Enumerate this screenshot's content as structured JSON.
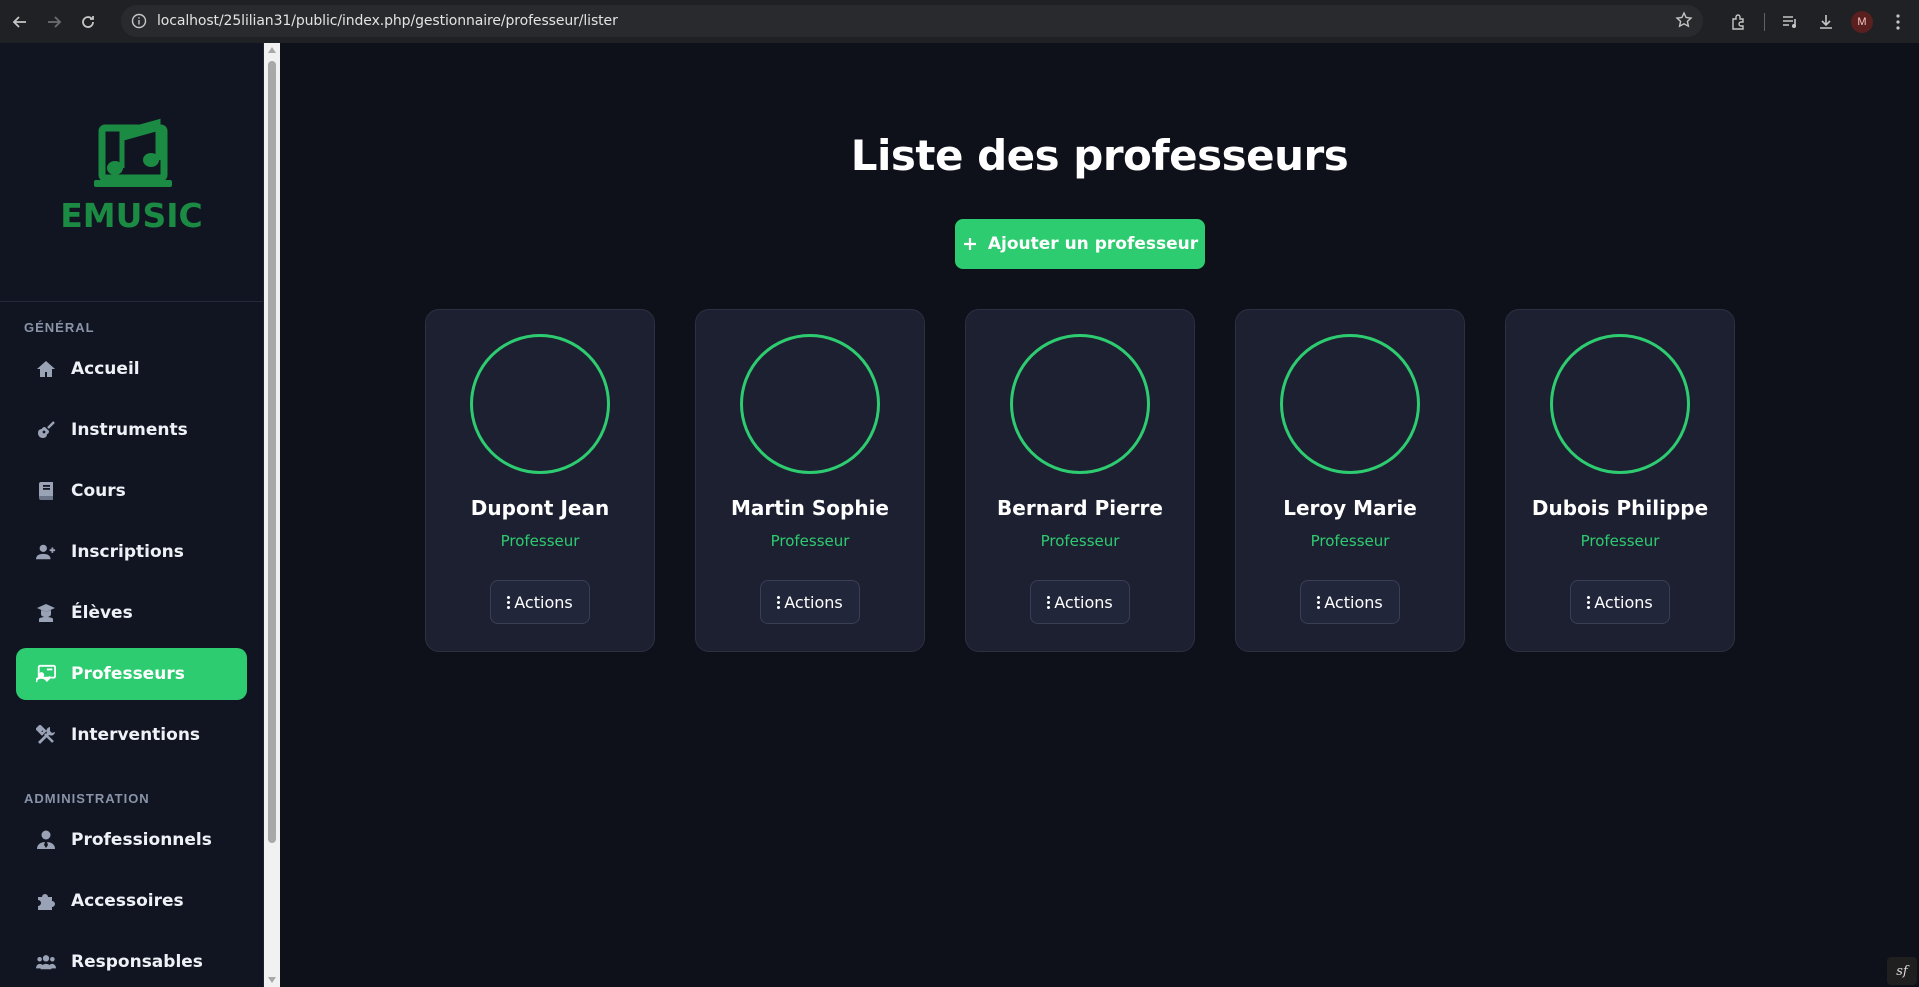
{
  "browser": {
    "url": "localhost/25lilian31/public/index.php/gestionnaire/professeur/lister",
    "profile_initial": "M"
  },
  "sidebar": {
    "logo_text": "EMUSIC",
    "sections": [
      {
        "title": "GÉNÉRAL",
        "items": [
          {
            "label": "Accueil",
            "icon": "home-icon",
            "active": false
          },
          {
            "label": "Instruments",
            "icon": "guitar-icon",
            "active": false
          },
          {
            "label": "Cours",
            "icon": "book-icon",
            "active": false
          },
          {
            "label": "Inscriptions",
            "icon": "user-plus-icon",
            "active": false
          },
          {
            "label": "Élèves",
            "icon": "graduation-icon",
            "active": false
          },
          {
            "label": "Professeurs",
            "icon": "teacher-icon",
            "active": true
          },
          {
            "label": "Interventions",
            "icon": "tools-icon",
            "active": false
          }
        ]
      },
      {
        "title": "ADMINISTRATION",
        "items": [
          {
            "label": "Professionnels",
            "icon": "user-tie-icon",
            "active": false
          },
          {
            "label": "Accessoires",
            "icon": "puzzle-icon",
            "active": false
          },
          {
            "label": "Responsables",
            "icon": "users-icon",
            "active": false
          }
        ]
      }
    ]
  },
  "main": {
    "title": "Liste des professeurs",
    "add_button_label": "Ajouter un professeur",
    "actions_label": "Actions",
    "teachers": [
      {
        "name": "Dupont Jean",
        "role": "Professeur"
      },
      {
        "name": "Martin Sophie",
        "role": "Professeur"
      },
      {
        "name": "Bernard Pierre",
        "role": "Professeur"
      },
      {
        "name": "Leroy Marie",
        "role": "Professeur"
      },
      {
        "name": "Dubois Philippe",
        "role": "Professeur"
      }
    ]
  },
  "colors": {
    "accent": "#2ecc71",
    "background": "#0e111a",
    "sidebar": "#111522",
    "card": "#1d2030",
    "logo": "#1b8a42"
  },
  "debug_badge": "sf"
}
